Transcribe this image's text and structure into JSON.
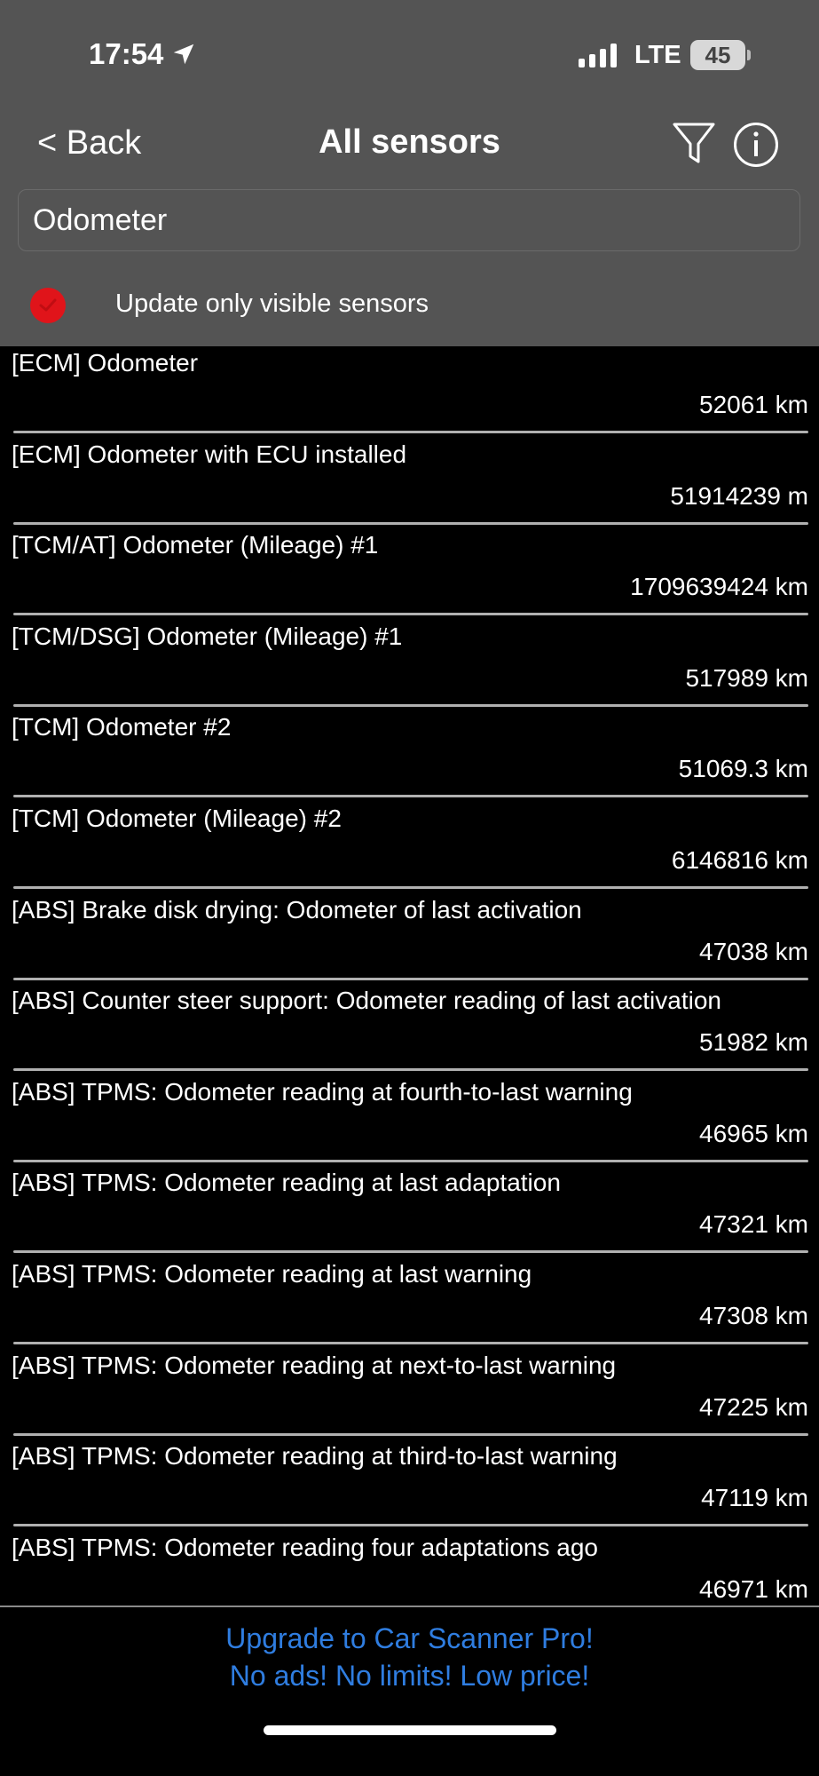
{
  "status_bar": {
    "time": "17:54",
    "network": "LTE",
    "battery": "45"
  },
  "nav": {
    "back_label": "< Back",
    "title": "All sensors"
  },
  "search": {
    "value": "Odometer"
  },
  "toggle": {
    "label": "Update only visible sensors",
    "checked": true,
    "color": "#e0141a"
  },
  "sensors": [
    {
      "name": "[ECM] Odometer",
      "value": "52061 km"
    },
    {
      "name": "[ECM] Odometer with ECU installed",
      "value": "51914239 m"
    },
    {
      "name": "[TCM/AT] Odometer (Mileage) #1",
      "value": "1709639424 km"
    },
    {
      "name": "[TCM/DSG] Odometer (Mileage) #1",
      "value": "517989 km"
    },
    {
      "name": "[TCM] Odometer #2",
      "value": "51069.3 km"
    },
    {
      "name": "[TCM] Odometer (Mileage) #2",
      "value": "6146816 km"
    },
    {
      "name": "[ABS] Brake disk drying: Odometer of last activation",
      "value": "47038 km"
    },
    {
      "name": "[ABS] Counter steer support: Odometer reading of last activation",
      "value": "51982 km"
    },
    {
      "name": "[ABS] TPMS: Odometer reading at fourth-to-last warning",
      "value": "46965 km"
    },
    {
      "name": "[ABS] TPMS: Odometer reading at last adaptation",
      "value": "47321 km"
    },
    {
      "name": "[ABS] TPMS: Odometer reading at last warning",
      "value": "47308 km"
    },
    {
      "name": "[ABS] TPMS: Odometer reading at next-to-last warning",
      "value": "47225 km"
    },
    {
      "name": "[ABS] TPMS: Odometer reading at third-to-last warning",
      "value": "47119 km"
    },
    {
      "name": "[ABS] TPMS: Odometer reading four adaptations ago",
      "value": "46971 km"
    }
  ],
  "ad": {
    "line1": "Upgrade to Car Scanner Pro!",
    "line2": "No ads! No limits! Low price!",
    "color": "#2f7de0"
  },
  "icons": {
    "location": "location-arrow-icon",
    "filter": "filter-icon",
    "info": "info-icon",
    "check": "checkmark-icon"
  }
}
